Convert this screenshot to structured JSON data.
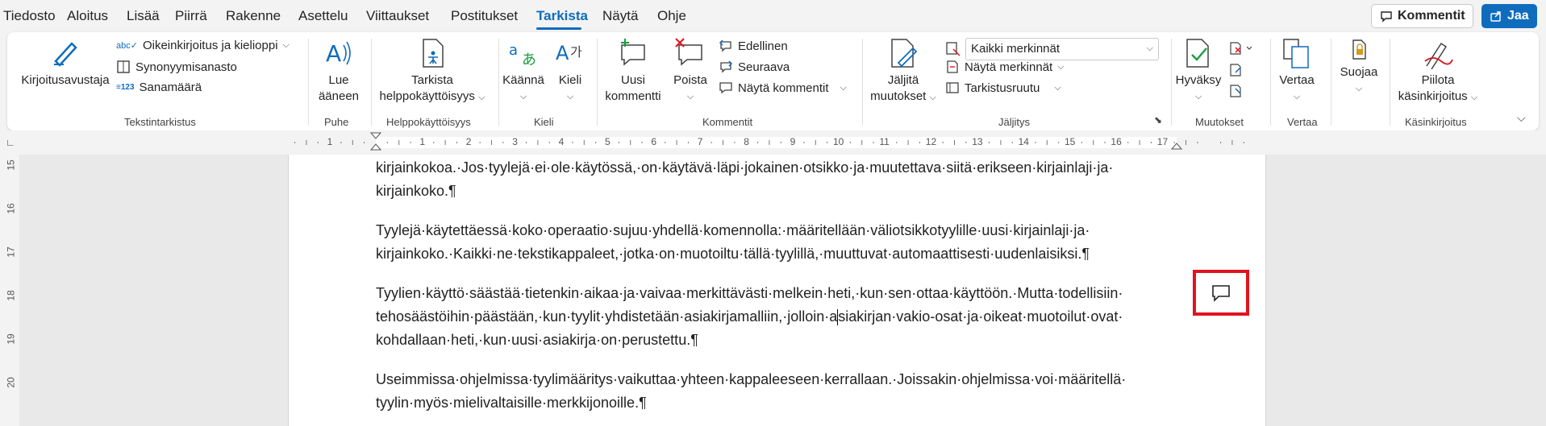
{
  "menu": {
    "tabs": [
      "Tiedosto",
      "Aloitus",
      "Lisää",
      "Piirrä",
      "Rakenne",
      "Asettelu",
      "Viittaukset",
      "Postitukset",
      "Tarkista",
      "Näytä",
      "Ohje"
    ],
    "active_tab": "Tarkista",
    "comments_button": "Kommentit",
    "share_button": "Jaa"
  },
  "ribbon": {
    "proofing": {
      "label": "Tekstintarkistus",
      "editor": "Kirjoitusavustaja",
      "spelling": "Oikeinkirjoitus ja kielioppi",
      "thesaurus": "Synonyymisanasto",
      "word_count": "Sanamäärä"
    },
    "speech": {
      "label": "Puhe",
      "read_aloud_1": "Lue",
      "read_aloud_2": "ääneen"
    },
    "accessibility": {
      "label": "Helppokäyttöisyys",
      "check_1": "Tarkista",
      "check_2": "helppokäyttöisyys"
    },
    "language": {
      "label": "Kieli",
      "translate": "Käännä",
      "language": "Kieli"
    },
    "comments": {
      "label": "Kommentit",
      "new_1": "Uusi",
      "new_2": "kommentti",
      "delete": "Poista",
      "previous": "Edellinen",
      "next": "Seuraava",
      "show": "Näytä kommentit"
    },
    "tracking": {
      "label": "Jäljitys",
      "track_1": "Jäljitä",
      "track_2": "muutokset",
      "markup_select": "Kaikki merkinnät",
      "show_markup": "Näytä merkinnät",
      "reviewing_pane": "Tarkistusruutu"
    },
    "changes": {
      "label": "Muutokset",
      "accept": "Hyväksy"
    },
    "compare": {
      "label": "Vertaa",
      "compare": "Vertaa"
    },
    "protect": {
      "protect": "Suojaa"
    },
    "ink": {
      "label": "Käsinkirjoitus",
      "hide_1": "Piilota",
      "hide_2": "käsinkirjoitus"
    }
  },
  "ruler": {
    "h_numbers": [
      "1",
      "1",
      "2",
      "3",
      "4",
      "5",
      "6",
      "7",
      "8",
      "9",
      "10",
      "11",
      "12",
      "13",
      "14",
      "15",
      "16",
      "17"
    ],
    "v_numbers": [
      "15",
      "16",
      "17",
      "18",
      "19",
      "20"
    ]
  },
  "document": {
    "p0_l1": "kirjainkokoa.·Jos·tyylejä·ei·ole·käytössä,·on·käytävä·läpi·jokainen·otsikko·ja·muutettava·siitä·erikseen·kirjainlaji·ja·",
    "p0_l2": "kirjainkoko.¶",
    "p1_l1": "Tyylejä·käytettäessä·koko·operaatio·sujuu·yhdellä·komennolla:·määritellään·väliotsikkotyylille·uusi·kirjainlaji·ja·",
    "p1_l2": "kirjainkoko.·Kaikki·ne·tekstikappaleet,·jotka·on·muotoiltu·tällä·tyylillä,·muuttuvat·automaattisesti·uudenlaisiksi.¶",
    "p2_l1": "Tyylien·käyttö·säästää·tietenkin·aikaa·ja·vaivaa·merkittävästi·melkein·heti,·kun·sen·ottaa·käyttöön.·Mutta·todellisiin·",
    "p2_l2a": "tehosäästöihin·päästään,·kun·tyylit·yhdistetään·asiakirjamalliin,·jolloin·a",
    "p2_l2b": "siakirjan·vakio-osat·ja·oikeat·muotoilut·ovat·",
    "p2_l3": "kohdallaan·heti,·kun·uusi·asiakirja·on·perustettu.¶",
    "p3_l1": "Useimmissa·ohjelmissa·tyylimääritys·vaikuttaa·yhteen·kappaleeseen·kerrallaan.·Joissakin·ohjelmissa·voi·määritellä·",
    "p3_l2": "tyylin·myös·mielivaltaisille·merkkijonoille.¶"
  },
  "colors": {
    "accent": "#0f6cbd",
    "highlight": "#e0141e"
  }
}
